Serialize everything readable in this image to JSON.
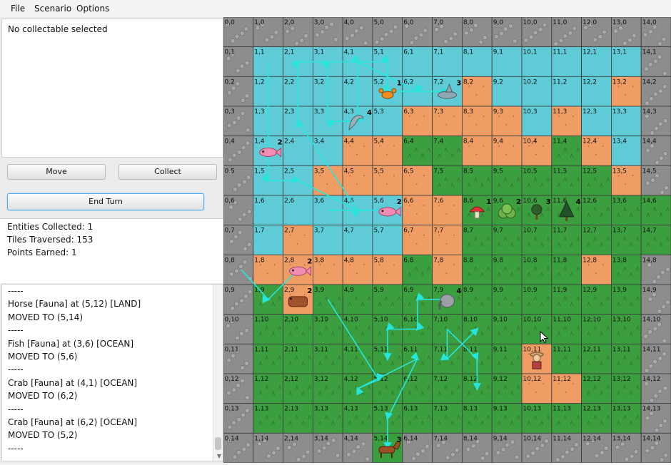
{
  "menu": {
    "file": "File",
    "scenario": "Scenario",
    "options": "Options"
  },
  "selection": {
    "text": "No collectable selected"
  },
  "buttons": {
    "move": "Move",
    "collect": "Collect",
    "end_turn": "End Turn"
  },
  "stats": {
    "entities": "Entities Collected: 1",
    "tiles": "Tiles Traversed: 153",
    "points": "Points Earned: 1"
  },
  "log": [
    "-----",
    "Horse [Fauna] at (5,12) [LAND]",
    "MOVED TO (5,14)",
    "-----",
    "Fish [Fauna] at (3,6) [OCEAN]",
    "MOVED TO (5,6)",
    "-----",
    "Crab [Fauna] at (4,1) [OCEAN]",
    "MOVED TO (6,2)",
    "-----",
    "Crab [Fauna] at (6,2) [OCEAN]",
    "MOVED TO (5,2)",
    "-----"
  ],
  "colors": {
    "ocean": "#5fcbd6",
    "land": "#3c9f3f",
    "sand": "#ef9d64",
    "rock": "#8d8d8d",
    "path": "#24e6dc"
  },
  "map": {
    "cols": 15,
    "rows": 15,
    "legend_codes": {
      "R": "rock",
      "O": "ocean",
      "S": "sand",
      "L": "land"
    },
    "terrain": [
      "RRRRRRRRRRRRRRR",
      "ROOOOOOOOOOOOOR",
      "ROOOOOOOSOOOOSR",
      "ROOOOOSSSSOSOOR",
      "ROOOSSLLSSSLSOR",
      "ROOSSSSLLLLLLSR",
      "ROOOOOSSLLLLLLL",
      "ROSOOOSSLLLLLLL",
      "RSSSSSLSLLLLSLR",
      "RLSLLLLLLLLLLLR",
      "RLLLLLLLLLLLLLR",
      "RLLLLLLLLLSLLLR",
      "RLLLLLLLLLSSLLR",
      "RLLLLLLLLLLLLLR",
      "RRRRRLRRRRRRRRR"
    ],
    "entities": [
      {
        "kind": "crab-icon",
        "x": 5,
        "y": 2,
        "count": "1"
      },
      {
        "kind": "shark-icon",
        "x": 7,
        "y": 2,
        "count": "3"
      },
      {
        "kind": "dolphin-icon",
        "x": 4,
        "y": 3,
        "count": "4"
      },
      {
        "kind": "fish-icon",
        "x": 1,
        "y": 4,
        "count": "2"
      },
      {
        "kind": "fish-icon",
        "x": 5,
        "y": 6,
        "count": "2"
      },
      {
        "kind": "mushroom-icon",
        "x": 8,
        "y": 6,
        "count": "1"
      },
      {
        "kind": "bush-icon",
        "x": 9,
        "y": 6,
        "count": "2"
      },
      {
        "kind": "tree-icon",
        "x": 10,
        "y": 6,
        "count": "3"
      },
      {
        "kind": "pine-icon",
        "x": 11,
        "y": 6,
        "count": "4"
      },
      {
        "kind": "fish-icon",
        "x": 2,
        "y": 8,
        "count": "2"
      },
      {
        "kind": "boar-icon",
        "x": 2,
        "y": 9,
        "count": "2"
      },
      {
        "kind": "elephant-icon",
        "x": 7,
        "y": 9,
        "count": "4"
      },
      {
        "kind": "explorer-icon",
        "x": 10,
        "y": 11,
        "count": ""
      },
      {
        "kind": "horse-icon",
        "x": 5,
        "y": 14,
        "count": "3"
      }
    ],
    "paths": [
      [
        [
          1.5,
          1.5
        ],
        [
          1.5,
          5.5
        ],
        [
          2.5,
          5.5
        ],
        [
          4.5,
          6.5
        ],
        [
          2.5,
          3.5
        ],
        [
          2.5,
          1.5
        ],
        [
          4.5,
          1.5
        ],
        [
          4.5,
          3.5
        ],
        [
          3.5,
          3.5
        ],
        [
          3.5,
          1.5
        ],
        [
          5.5,
          1.5
        ],
        [
          5.5,
          2.5
        ],
        [
          7.5,
          2.5
        ]
      ],
      [
        [
          3.5,
          6.5
        ],
        [
          5.5,
          6.5
        ]
      ],
      [
        [
          4.5,
          1.5
        ],
        [
          6.5,
          2.5
        ],
        [
          5.5,
          2.5
        ]
      ],
      [
        [
          0.6,
          8.5
        ],
        [
          1.5,
          9.5
        ],
        [
          2.5,
          8.5
        ]
      ],
      [
        [
          3.5,
          9.5
        ],
        [
          5.2,
          12.2
        ],
        [
          4.5,
          12.5
        ],
        [
          6.5,
          11.5
        ],
        [
          5.5,
          13.5
        ],
        [
          5.5,
          14.5
        ]
      ],
      [
        [
          7.5,
          9.5
        ],
        [
          6.5,
          9.5
        ],
        [
          6.5,
          10.5
        ],
        [
          5.5,
          10.5
        ],
        [
          5.5,
          11.5
        ]
      ],
      [
        [
          7.5,
          10.5
        ],
        [
          8.5,
          11.5
        ],
        [
          8.5,
          12.5
        ]
      ],
      [
        [
          7.5,
          10.5
        ],
        [
          7.5,
          11.5
        ],
        [
          8.5,
          10.5
        ]
      ]
    ]
  }
}
